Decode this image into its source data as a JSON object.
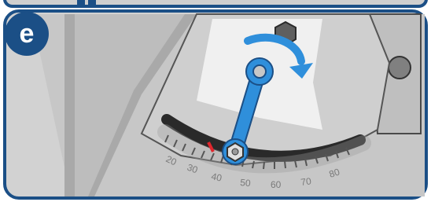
{
  "panel": {
    "step_label": "e",
    "scale_labels": [
      "20",
      "30",
      "40",
      "50",
      "60",
      "70",
      "80"
    ]
  },
  "colors": {
    "frame": "#1b4f86",
    "badge": "#1b4f86",
    "wrench": "#2f8fdb",
    "arrow": "#2f8fdb",
    "indicator": "#e0262d",
    "metal_light": "#d7d7d7",
    "metal_mid": "#bdbdbd",
    "metal_dark": "#8a8a8a"
  },
  "icons": {
    "rotate_arrow": "clockwise-arrow-icon",
    "tool": "wrench-icon",
    "nut": "hex-nut-icon"
  }
}
